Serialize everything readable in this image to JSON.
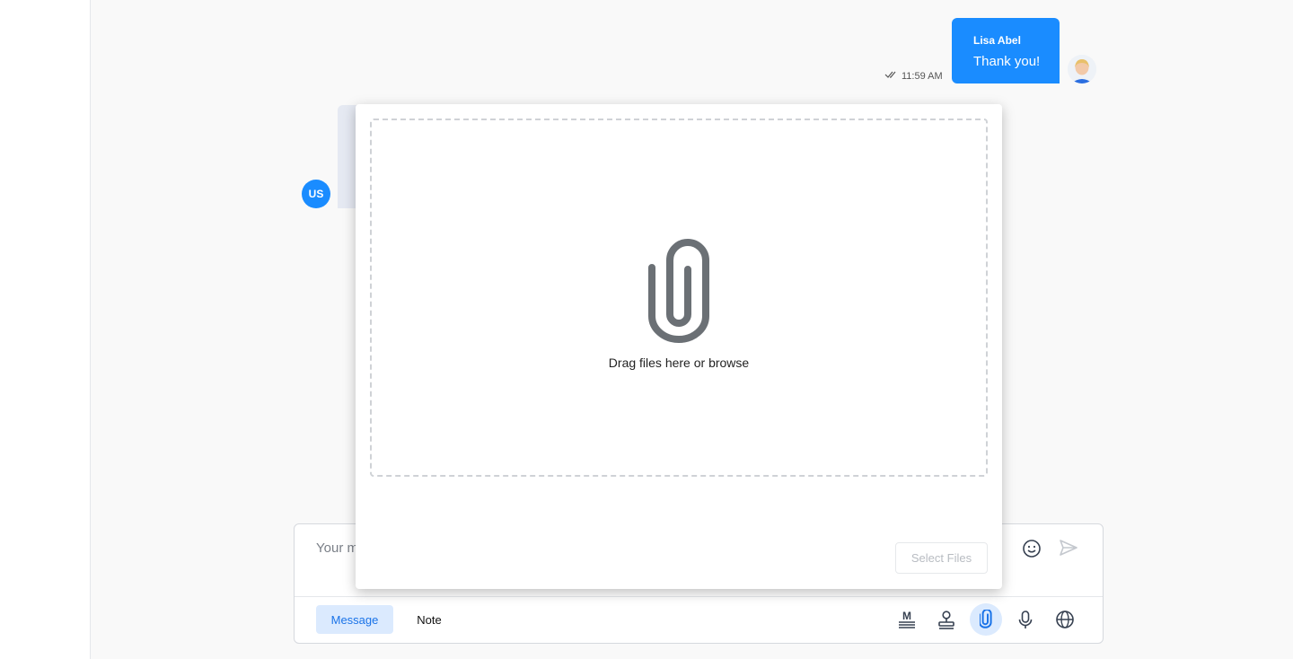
{
  "conversation": {
    "outgoing": {
      "sender": "Lisa Abel",
      "text": "Thank you!",
      "time": "11:59 AM",
      "status_icon": "double-check-icon",
      "avatar": "lisa-avatar"
    },
    "incoming": {
      "avatar_initials": "US"
    }
  },
  "composer": {
    "placeholder": "Your message",
    "tabs": [
      {
        "label": "Message",
        "active": true
      },
      {
        "label": "Note",
        "active": false
      }
    ],
    "tools": [
      "markdown-icon",
      "stamp-icon",
      "paperclip-icon",
      "microphone-icon",
      "globe-icon"
    ],
    "active_tool": "paperclip-icon",
    "emoji_icon": "emoji-icon",
    "send_icon": "send-icon"
  },
  "upload_modal": {
    "dropzone_text": "Drag files here or browse",
    "dropzone_icon": "paperclip-icon",
    "select_button": "Select Files"
  },
  "colors": {
    "accent": "#1a8cff",
    "active_tab_bg": "#dbeafe",
    "active_tab_text": "#1a73e8",
    "incoming_bubble": "#e5e9f2",
    "icon_gray": "#6b7280"
  }
}
